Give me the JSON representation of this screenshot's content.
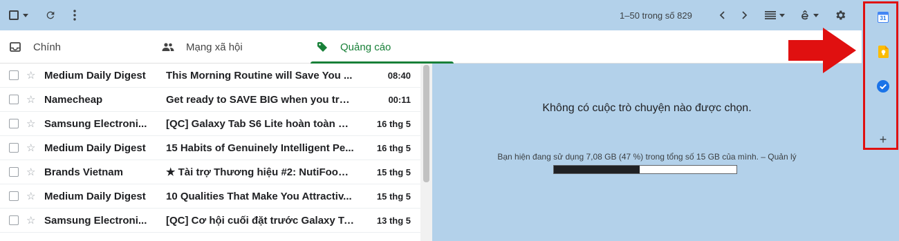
{
  "toolbar": {
    "pager": "1–50 trong số 829"
  },
  "tabs": [
    {
      "label": "Chính",
      "icon": "inbox-icon",
      "active": false
    },
    {
      "label": "Mạng xã hội",
      "icon": "people-icon",
      "active": false
    },
    {
      "label": "Quảng cáo",
      "icon": "tag-icon",
      "active": true
    }
  ],
  "emails": [
    {
      "sender": "Medium Daily Digest",
      "subject": "This Morning Routine will Save You ...",
      "date": "08:40"
    },
    {
      "sender": "Namecheap",
      "subject": "Get ready to SAVE BIG when you tran...",
      "date": "00:11"
    },
    {
      "sender": "Samsung Electroni...",
      "subject": "[QC] Galaxy Tab S6 Lite hoàn toàn m...",
      "date": "16 thg 5"
    },
    {
      "sender": "Medium Daily Digest",
      "subject": "15 Habits of Genuinely Intelligent Pe...",
      "date": "16 thg 5"
    },
    {
      "sender": "Brands Vietnam",
      "subject": "★ Tài trợ Thương hiệu #2: NutiFood ...",
      "date": "15 thg 5"
    },
    {
      "sender": "Medium Daily Digest",
      "subject": "10 Qualities That Make You Attractiv...",
      "date": "15 thg 5"
    },
    {
      "sender": "Samsung Electroni...",
      "subject": "[QC] Cơ hội cuối đặt trước Galaxy Ta...",
      "date": "13 thg 5"
    }
  ],
  "pane": {
    "empty_message": "Không có cuộc trò chuyện nào được chọn.",
    "storage_text": "Bạn hiện đang sử dụng 7,08 GB (47 %) trong tổng số 15 GB của mình. – ",
    "manage_link": "Quản lý",
    "storage_fraction": 0.47
  },
  "sidepanel": {
    "icons": [
      "calendar-icon",
      "keep-icon",
      "tasks-icon",
      "add-icon"
    ],
    "calendar_day": "31",
    "add_label": "+"
  },
  "colors": {
    "accent_green": "#188038",
    "annotation_red": "#e01010"
  }
}
